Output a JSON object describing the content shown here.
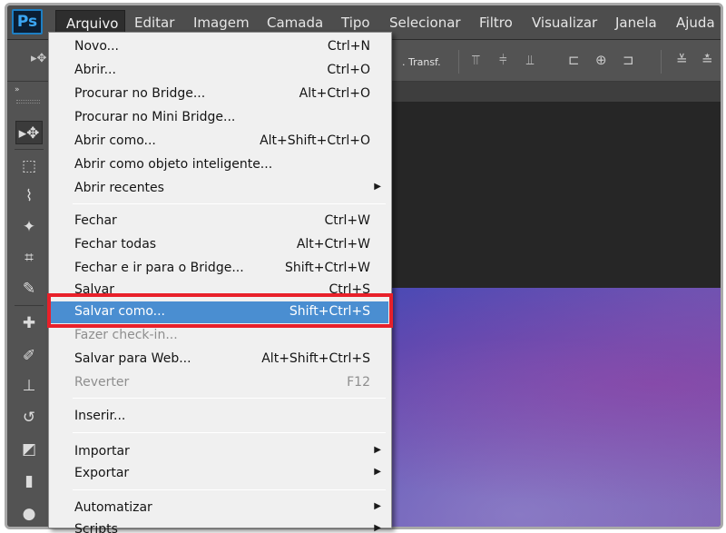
{
  "app": {
    "logo": "Ps",
    "menubar": [
      {
        "label": "Arquivo"
      },
      {
        "label": "Editar"
      },
      {
        "label": "Imagem"
      },
      {
        "label": "Camada"
      },
      {
        "label": "Tipo"
      },
      {
        "label": "Selecionar"
      },
      {
        "label": "Filtro"
      },
      {
        "label": "Visualizar"
      },
      {
        "label": "Janela"
      },
      {
        "label": "Ajuda"
      }
    ]
  },
  "options_bar": {
    "transform_label": ". Transf.",
    "icons": [
      "align-top-icon",
      "align-vertical-center-icon",
      "align-bottom-icon",
      "align-left-icon",
      "align-horizontal-center-icon",
      "align-right-icon",
      "distribute-top-icon",
      "distribute-center-icon"
    ]
  },
  "tools": {
    "collapse_label": "»",
    "items": [
      {
        "name": "move-tool-icon",
        "glyph": "▸✥",
        "active": true
      },
      {
        "name": "marquee-tool-icon",
        "glyph": "⬚"
      },
      {
        "name": "lasso-tool-icon",
        "glyph": "⌇"
      },
      {
        "name": "magic-wand-tool-icon",
        "glyph": "✦"
      },
      {
        "name": "crop-tool-icon",
        "glyph": "⌗"
      },
      {
        "name": "eyedropper-tool-icon",
        "glyph": "✎"
      },
      {
        "name": "healing-brush-tool-icon",
        "glyph": "✚"
      },
      {
        "name": "brush-tool-icon",
        "glyph": "✐"
      },
      {
        "name": "clone-stamp-tool-icon",
        "glyph": "⊥"
      },
      {
        "name": "history-brush-tool-icon",
        "glyph": "↺"
      },
      {
        "name": "eraser-tool-icon",
        "glyph": "◩"
      },
      {
        "name": "gradient-tool-icon",
        "glyph": "▮"
      },
      {
        "name": "blur-tool-icon",
        "glyph": "●"
      }
    ]
  },
  "file_menu": {
    "items": [
      {
        "label": "Novo...",
        "shortcut": "Ctrl+N"
      },
      {
        "label": "Abrir...",
        "shortcut": "Ctrl+O"
      },
      {
        "label": "Procurar no Bridge...",
        "shortcut": "Alt+Ctrl+O"
      },
      {
        "label": "Procurar no Mini Bridge...",
        "shortcut": ""
      },
      {
        "label": "Abrir como...",
        "shortcut": "Alt+Shift+Ctrl+O"
      },
      {
        "label": "Abrir como objeto inteligente...",
        "shortcut": ""
      },
      {
        "label": "Abrir recentes",
        "shortcut": "",
        "submenu": true
      },
      {
        "label": "Fechar",
        "shortcut": "Ctrl+W"
      },
      {
        "label": "Fechar todas",
        "shortcut": "Alt+Ctrl+W"
      },
      {
        "label": "Fechar e ir para o Bridge...",
        "shortcut": "Shift+Ctrl+W"
      },
      {
        "label": "Salvar",
        "shortcut": "Ctrl+S"
      },
      {
        "label": "Salvar como...",
        "shortcut": "Shift+Ctrl+S",
        "highlighted": true
      },
      {
        "label": "Fazer check-in...",
        "shortcut": "",
        "disabled": true
      },
      {
        "label": "Salvar para Web...",
        "shortcut": "Alt+Shift+Ctrl+S"
      },
      {
        "label": "Reverter",
        "shortcut": "F12",
        "disabled": true
      },
      {
        "label": "Inserir...",
        "shortcut": ""
      },
      {
        "label": "Importar",
        "shortcut": "",
        "submenu": true
      },
      {
        "label": "Exportar",
        "shortcut": "",
        "submenu": true
      },
      {
        "label": "Automatizar",
        "shortcut": "",
        "submenu": true
      },
      {
        "label": "Scripts",
        "shortcut": "",
        "submenu": true
      }
    ],
    "submenu_arrow": "▶"
  },
  "colors": {
    "highlight": "#4a8ed1",
    "callout": "#e8202a"
  }
}
